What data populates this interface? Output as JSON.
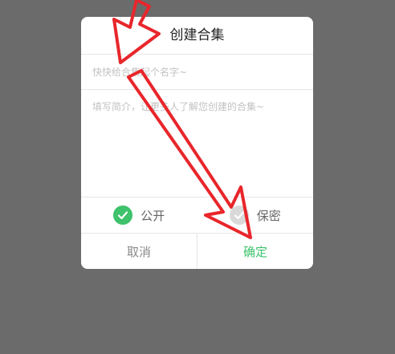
{
  "dialog": {
    "title": "创建合集",
    "name_placeholder": "快快给合集起个名字~",
    "description_placeholder": "填写简介，让更多人了解您创建的合集~"
  },
  "privacy": {
    "public_label": "公开",
    "private_label": "保密",
    "selected": "public"
  },
  "actions": {
    "cancel_label": "取消",
    "confirm_label": "确定"
  },
  "colors": {
    "overlay": "#6b6b6b",
    "accent_green": "#3ec26b",
    "annotation_red": "#e8262b"
  }
}
